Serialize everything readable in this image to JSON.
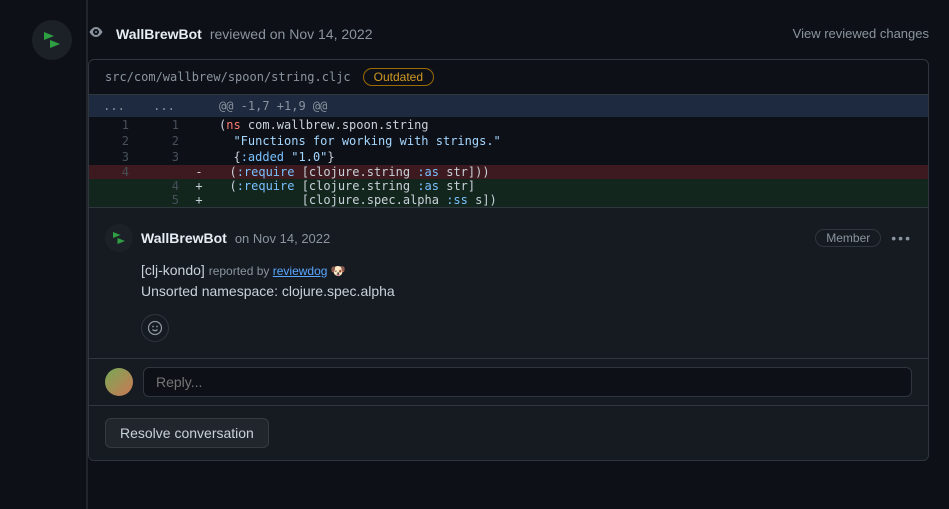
{
  "review": {
    "reviewer": "WallBrewBot",
    "action_text": "reviewed on Nov 14, 2022",
    "view_changes": "View reviewed changes"
  },
  "diff": {
    "file_path": "src/com/wallbrew/spoon/string.cljc",
    "outdated_label": "Outdated",
    "hunk_header": "@@ -1,7 +1,9 @@",
    "ellipsis": "...",
    "lines": [
      {
        "type": "context",
        "old": "1",
        "new": "1",
        "sign": " ",
        "seg": [
          [
            "(",
            "paren"
          ],
          [
            "ns",
            "kw"
          ],
          [
            " com.wallbrew.spoon.string",
            "ns"
          ]
        ]
      },
      {
        "type": "context",
        "old": "2",
        "new": "2",
        "sign": " ",
        "seg": [
          [
            "  ",
            ""
          ],
          [
            "\"Functions for working with strings.\"",
            "str"
          ]
        ]
      },
      {
        "type": "context",
        "old": "3",
        "new": "3",
        "sign": " ",
        "seg": [
          [
            "  {",
            ""
          ],
          [
            ":added",
            "key"
          ],
          [
            " ",
            ""
          ],
          [
            "\"1.0\"",
            "str"
          ],
          [
            "}",
            ""
          ]
        ]
      },
      {
        "type": "del",
        "old": "4",
        "new": "",
        "sign": "-",
        "seg": [
          [
            "  (",
            ""
          ],
          [
            ":require",
            "key"
          ],
          [
            " [clojure.string ",
            ""
          ],
          [
            ":as",
            "key"
          ],
          [
            " str]))",
            ""
          ]
        ]
      },
      {
        "type": "add",
        "old": "",
        "new": "4",
        "sign": "+",
        "seg": [
          [
            "  (",
            ""
          ],
          [
            ":require",
            "key"
          ],
          [
            " [clojure.string ",
            ""
          ],
          [
            ":as",
            "key"
          ],
          [
            " str]",
            ""
          ]
        ]
      },
      {
        "type": "add",
        "old": "",
        "new": "5",
        "sign": "+",
        "seg": [
          [
            "            [clojure.spec.alpha ",
            ""
          ],
          [
            ":ss",
            "key"
          ],
          [
            " s])",
            ""
          ]
        ]
      }
    ]
  },
  "comment": {
    "author": "WallBrewBot",
    "time": "on Nov 14, 2022",
    "badge": "Member",
    "tool": "[clj-kondo]",
    "reported_label": "reported by",
    "reporter": "reviewdog",
    "dog": "🐶",
    "body_line": "Unsorted namespace: clojure.spec.alpha"
  },
  "reply": {
    "placeholder": "Reply..."
  },
  "actions": {
    "resolve": "Resolve conversation"
  }
}
